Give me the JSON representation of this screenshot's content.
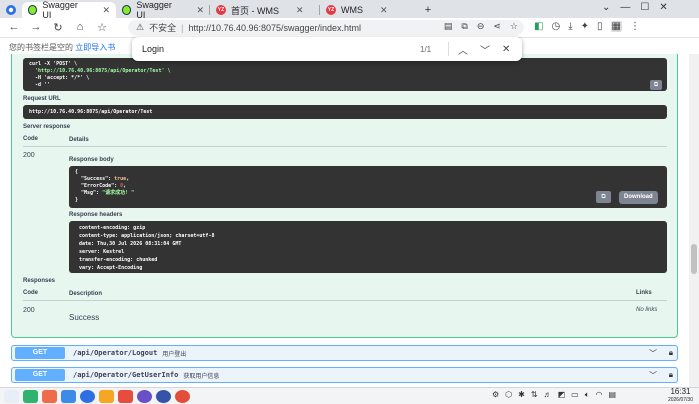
{
  "browser": {
    "tabs": [
      {
        "title": "Swagger UI",
        "active": true
      },
      {
        "title": "Swagger UI",
        "active": false
      },
      {
        "title": "首页 - WMS",
        "active": false
      },
      {
        "title": "WMS",
        "active": false
      }
    ],
    "address": {
      "insecure_label": "不安全",
      "url": "http://10.76.40.96:8075/swagger/index.html"
    },
    "bookmark_bar": {
      "prompt": "您的书签栏是空的",
      "link": "立即导入书"
    },
    "find": {
      "query": "Login",
      "count": "1/1"
    }
  },
  "swagger": {
    "curl": {
      "line1": "curl -X 'POST' \\",
      "line2": "  'http://10.76.40.96:8075/api/Operator/Test' \\",
      "line3": "  -H 'accept: */*' \\",
      "line4": "  -d ''"
    },
    "request_url_label": "Request URL",
    "request_url": "http://10.76.40.96:8075/api/Operator/Test",
    "server_response_label": "Server response",
    "code_header": "Code",
    "details_header": "Details",
    "response_code": "200",
    "response_body_label": "Response body",
    "response_body": {
      "open": "{",
      "success_key": "  \"Success\": ",
      "success_val": "true",
      "errorcode_key": "  \"ErrorCode\": ",
      "errorcode_val": "0",
      "msg_key": "  \"Msg\": ",
      "msg_val": "\"请求成功! \"",
      "close": "}"
    },
    "download_label": "Download",
    "response_headers_label": "Response headers",
    "response_headers": [
      "content-encoding: gzip",
      "content-type: application/json; charset=utf-8",
      "date: Thu,30 Jul 2026 08:31:04 GMT",
      "server: Kestrel",
      "transfer-encoding: chunked",
      "vary: Accept-Encoding"
    ],
    "responses_label": "Responses",
    "responses_code_header": "Code",
    "description_header": "Description",
    "links_header": "Links",
    "responses_code": "200",
    "responses_description": "Success",
    "no_links": "No links",
    "endpoints": [
      {
        "method": "GET",
        "path": "/api/Operator/Logout",
        "summary": "用户登出"
      },
      {
        "method": "GET",
        "path": "/api/Operator/GetUserInfo",
        "summary": "获取用户信息"
      }
    ]
  },
  "taskbar": {
    "time": "16:31",
    "date": "2026/07/30"
  },
  "colors": {
    "post_green": "#49cc90",
    "get_blue": "#61affe",
    "code_bg": "#333333"
  }
}
